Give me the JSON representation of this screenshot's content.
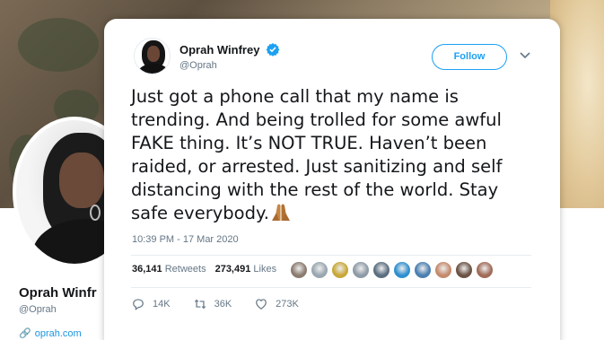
{
  "profile": {
    "name": "Oprah Winfr",
    "handle": "@Oprah",
    "link": "oprah.com"
  },
  "tweet": {
    "author_name": "Oprah Winfrey",
    "author_handle": "@Oprah",
    "verified": true,
    "follow_label": "Follow",
    "text": "Just got a phone call that my name is trending. And being trolled for some awful FAKE thing. It’s NOT TRUE. Haven’t been raided, or arrested. Just sanitizing and self distancing with the rest of the world. Stay safe everybody.",
    "emoji": "folded-hands",
    "timestamp": "10:39 PM - 17 Mar 2020",
    "retweets_count": "36,141",
    "retweets_label": "Retweets",
    "likes_count": "273,491",
    "likes_label": "Likes",
    "reply_count": "14K",
    "retweet_count": "36K",
    "like_count": "273K"
  },
  "likers": [
    {
      "color": "#8c7b6f"
    },
    {
      "color": "#9aa6b0"
    },
    {
      "color": "#c8a83a"
    },
    {
      "color": "#8e9aa6"
    },
    {
      "color": "#5b6f80"
    },
    {
      "color": "#2f8fcf"
    },
    {
      "color": "#4a7fb0"
    },
    {
      "color": "#c48a6c"
    },
    {
      "color": "#6b5244"
    },
    {
      "color": "#a06b58"
    }
  ],
  "colors": {
    "accent": "#1da1f2",
    "text": "#14171a",
    "muted": "#657786"
  }
}
